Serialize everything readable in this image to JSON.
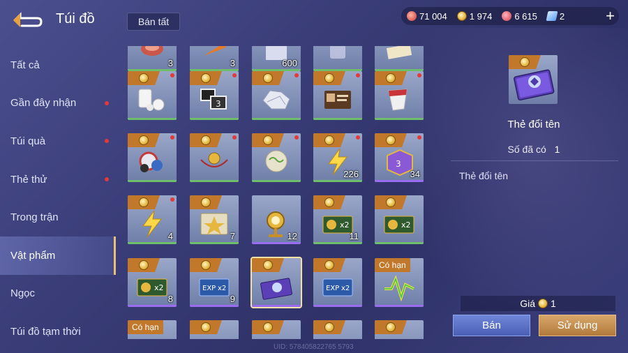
{
  "header": {
    "title": "Túi đồ",
    "sell_all_label": "Bán tất",
    "currencies": [
      {
        "icon": "red-gem-icon",
        "value": "71 004",
        "color": "#d9534f"
      },
      {
        "icon": "gold-coin-icon",
        "value": "1 974",
        "color": "#e6b73f"
      },
      {
        "icon": "ruby-icon",
        "value": "6 615",
        "color": "#e0505a"
      },
      {
        "icon": "ticket-icon",
        "value": "2",
        "color": "#6fb3ff"
      }
    ],
    "plus_label": "+"
  },
  "sidebar": {
    "items": [
      {
        "label": "Tất cả",
        "dot": false
      },
      {
        "label": "Gần đây nhận",
        "dot": true
      },
      {
        "label": "Túi quà",
        "dot": true
      },
      {
        "label": "Thẻ thử",
        "dot": true
      },
      {
        "label": "Trong trận",
        "dot": false
      },
      {
        "label": "Vật phẩm",
        "dot": false,
        "active": true
      },
      {
        "label": "Ngọc",
        "dot": false
      },
      {
        "label": "Túi đồ tạm thời",
        "dot": false
      }
    ]
  },
  "grid": {
    "rows": [
      [
        {
          "icon": "meat-icon",
          "count": "3",
          "bar": "green"
        },
        {
          "icon": "carrot-icon",
          "count": "3",
          "bar": "green"
        },
        {
          "icon": "box-icon",
          "count": "600",
          "bar": "green"
        },
        {
          "icon": "item-icon",
          "count": "",
          "bar": "green"
        },
        {
          "icon": "paper-icon",
          "count": "",
          "bar": "green"
        }
      ],
      [
        {
          "icon": "pills-icon",
          "count": "",
          "bar": "green",
          "tag": true,
          "dot": true
        },
        {
          "icon": "photo-cards-icon",
          "count": "",
          "bar": "green",
          "tag": true,
          "dot": true
        },
        {
          "icon": "crumpled-paper-icon",
          "count": "",
          "bar": "green",
          "tag": true,
          "dot": true
        },
        {
          "icon": "id-card-icon",
          "count": "",
          "bar": "green",
          "tag": true,
          "dot": true
        },
        {
          "icon": "paper-cup-icon",
          "count": "",
          "bar": "green",
          "tag": true,
          "dot": true
        }
      ],
      [
        {
          "icon": "dice-chips-icon",
          "count": "",
          "bar": "green",
          "tag": true,
          "dot": true
        },
        {
          "icon": "amulet-icon",
          "count": "",
          "bar": "green",
          "tag": true,
          "dot": true
        },
        {
          "icon": "glass-orb-icon",
          "count": "",
          "bar": "green",
          "tag": true,
          "dot": true
        },
        {
          "icon": "lightning-icon",
          "count": "226",
          "bar": "green",
          "tag": true,
          "dot": true
        },
        {
          "icon": "purple-die-icon",
          "count": "34",
          "bar": "purple",
          "tag": true,
          "dot": true
        }
      ],
      [
        {
          "icon": "lightning-icon",
          "count": "4",
          "bar": "green",
          "tag": true,
          "dot": true
        },
        {
          "icon": "star-badge-icon",
          "count": "7",
          "bar": "green",
          "tag": true,
          "dot": false
        },
        {
          "icon": "golden-trophy-icon",
          "count": "12",
          "bar": "purple",
          "tag": false,
          "dot": false
        },
        {
          "icon": "x2-card-icon",
          "count": "11",
          "bar": "green",
          "tag": true,
          "dot": false
        },
        {
          "icon": "x2-card-icon",
          "count": "",
          "bar": "green",
          "tag": true,
          "dot": false
        }
      ],
      [
        {
          "icon": "x2-card-icon",
          "count": "8",
          "bar": "purple",
          "tag": true,
          "dot": false
        },
        {
          "icon": "exp-x2-card-icon",
          "count": "9",
          "bar": "purple",
          "tag": true,
          "dot": false
        },
        {
          "icon": "rename-card-icon",
          "count": "",
          "bar": "purple",
          "tag": true,
          "dot": false,
          "selected": true
        },
        {
          "icon": "exp-x2-card-icon",
          "count": "",
          "bar": "purple",
          "tag": true,
          "dot": false
        },
        {
          "icon": "green-yellow-lightning-icon",
          "count": "",
          "bar": "purple",
          "tag": false,
          "dot": false,
          "label": "Có hạn"
        }
      ],
      [
        {
          "icon": "item-icon",
          "count": "",
          "bar": "none",
          "tag": false,
          "dot": false,
          "label": "Có hạn"
        },
        {
          "icon": "item-icon",
          "count": "",
          "bar": "none",
          "tag": true,
          "dot": false
        },
        {
          "icon": "item-icon",
          "count": "",
          "bar": "none",
          "tag": true,
          "dot": false
        },
        {
          "icon": "item-icon",
          "count": "",
          "bar": "none",
          "tag": true,
          "dot": false
        },
        {
          "icon": "item-icon",
          "count": "",
          "bar": "none",
          "tag": true,
          "dot": false
        }
      ]
    ]
  },
  "detail": {
    "name": "Thẻ đổi tên",
    "owned_label": "Số đã có",
    "owned_value": "1",
    "description": "Thẻ đổi tên",
    "price_label": "Giá",
    "price_value": "1",
    "sell_label": "Bán",
    "use_label": "Sử dụng"
  },
  "footer": {
    "uid": "UID: 578405822765 5793"
  },
  "colors": {
    "accent_orange": "#c2782a",
    "bar_green": "#6fbf6a",
    "bar_purple": "#9a6cf0",
    "active_border": "#e9c07a",
    "notify_red": "#e23a3a"
  }
}
